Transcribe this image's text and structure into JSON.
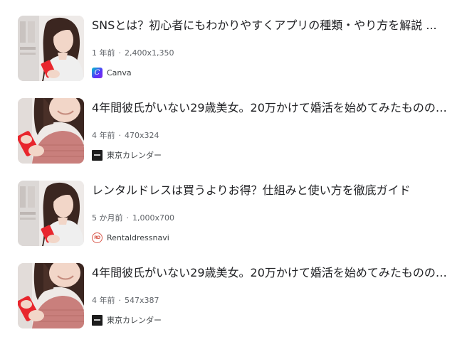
{
  "results": [
    {
      "title": "SNSとは？初心者にもわかりやすくアプリの種類・やり方を解説 ...",
      "age": "1 年前",
      "dimensions": "2,400x1,350",
      "source": "Canva",
      "favicon": "canva-icon",
      "favicon_letter": "C"
    },
    {
      "title": "4年間彼氏がいない29歳美女。20万かけて婚活を始めてみたものの…",
      "age": "4 年前",
      "dimensions": "470x324",
      "source": "東京カレンダー",
      "favicon": "tokyo-calendar-icon"
    },
    {
      "title": "レンタルドレスは買うよりお得？仕組みと使い方を徹底ガイド",
      "age": "5 か月前",
      "dimensions": "1,000x700",
      "source": "Rentaldressnavi",
      "favicon": "rentaldressnavi-icon",
      "favicon_letter": "RD"
    },
    {
      "title": "4年間彼氏がいない29歳美女。20万かけて婚活を始めてみたものの…",
      "age": "4 年前",
      "dimensions": "547x387",
      "source": "東京カレンダー",
      "favicon": "tokyo-calendar-icon"
    }
  ],
  "separator": "·",
  "colors": {
    "title": "#202124",
    "meta": "#5f6368",
    "phone": "#e8262d",
    "hair": "#3b2620",
    "shirt": "#c97f7c"
  }
}
